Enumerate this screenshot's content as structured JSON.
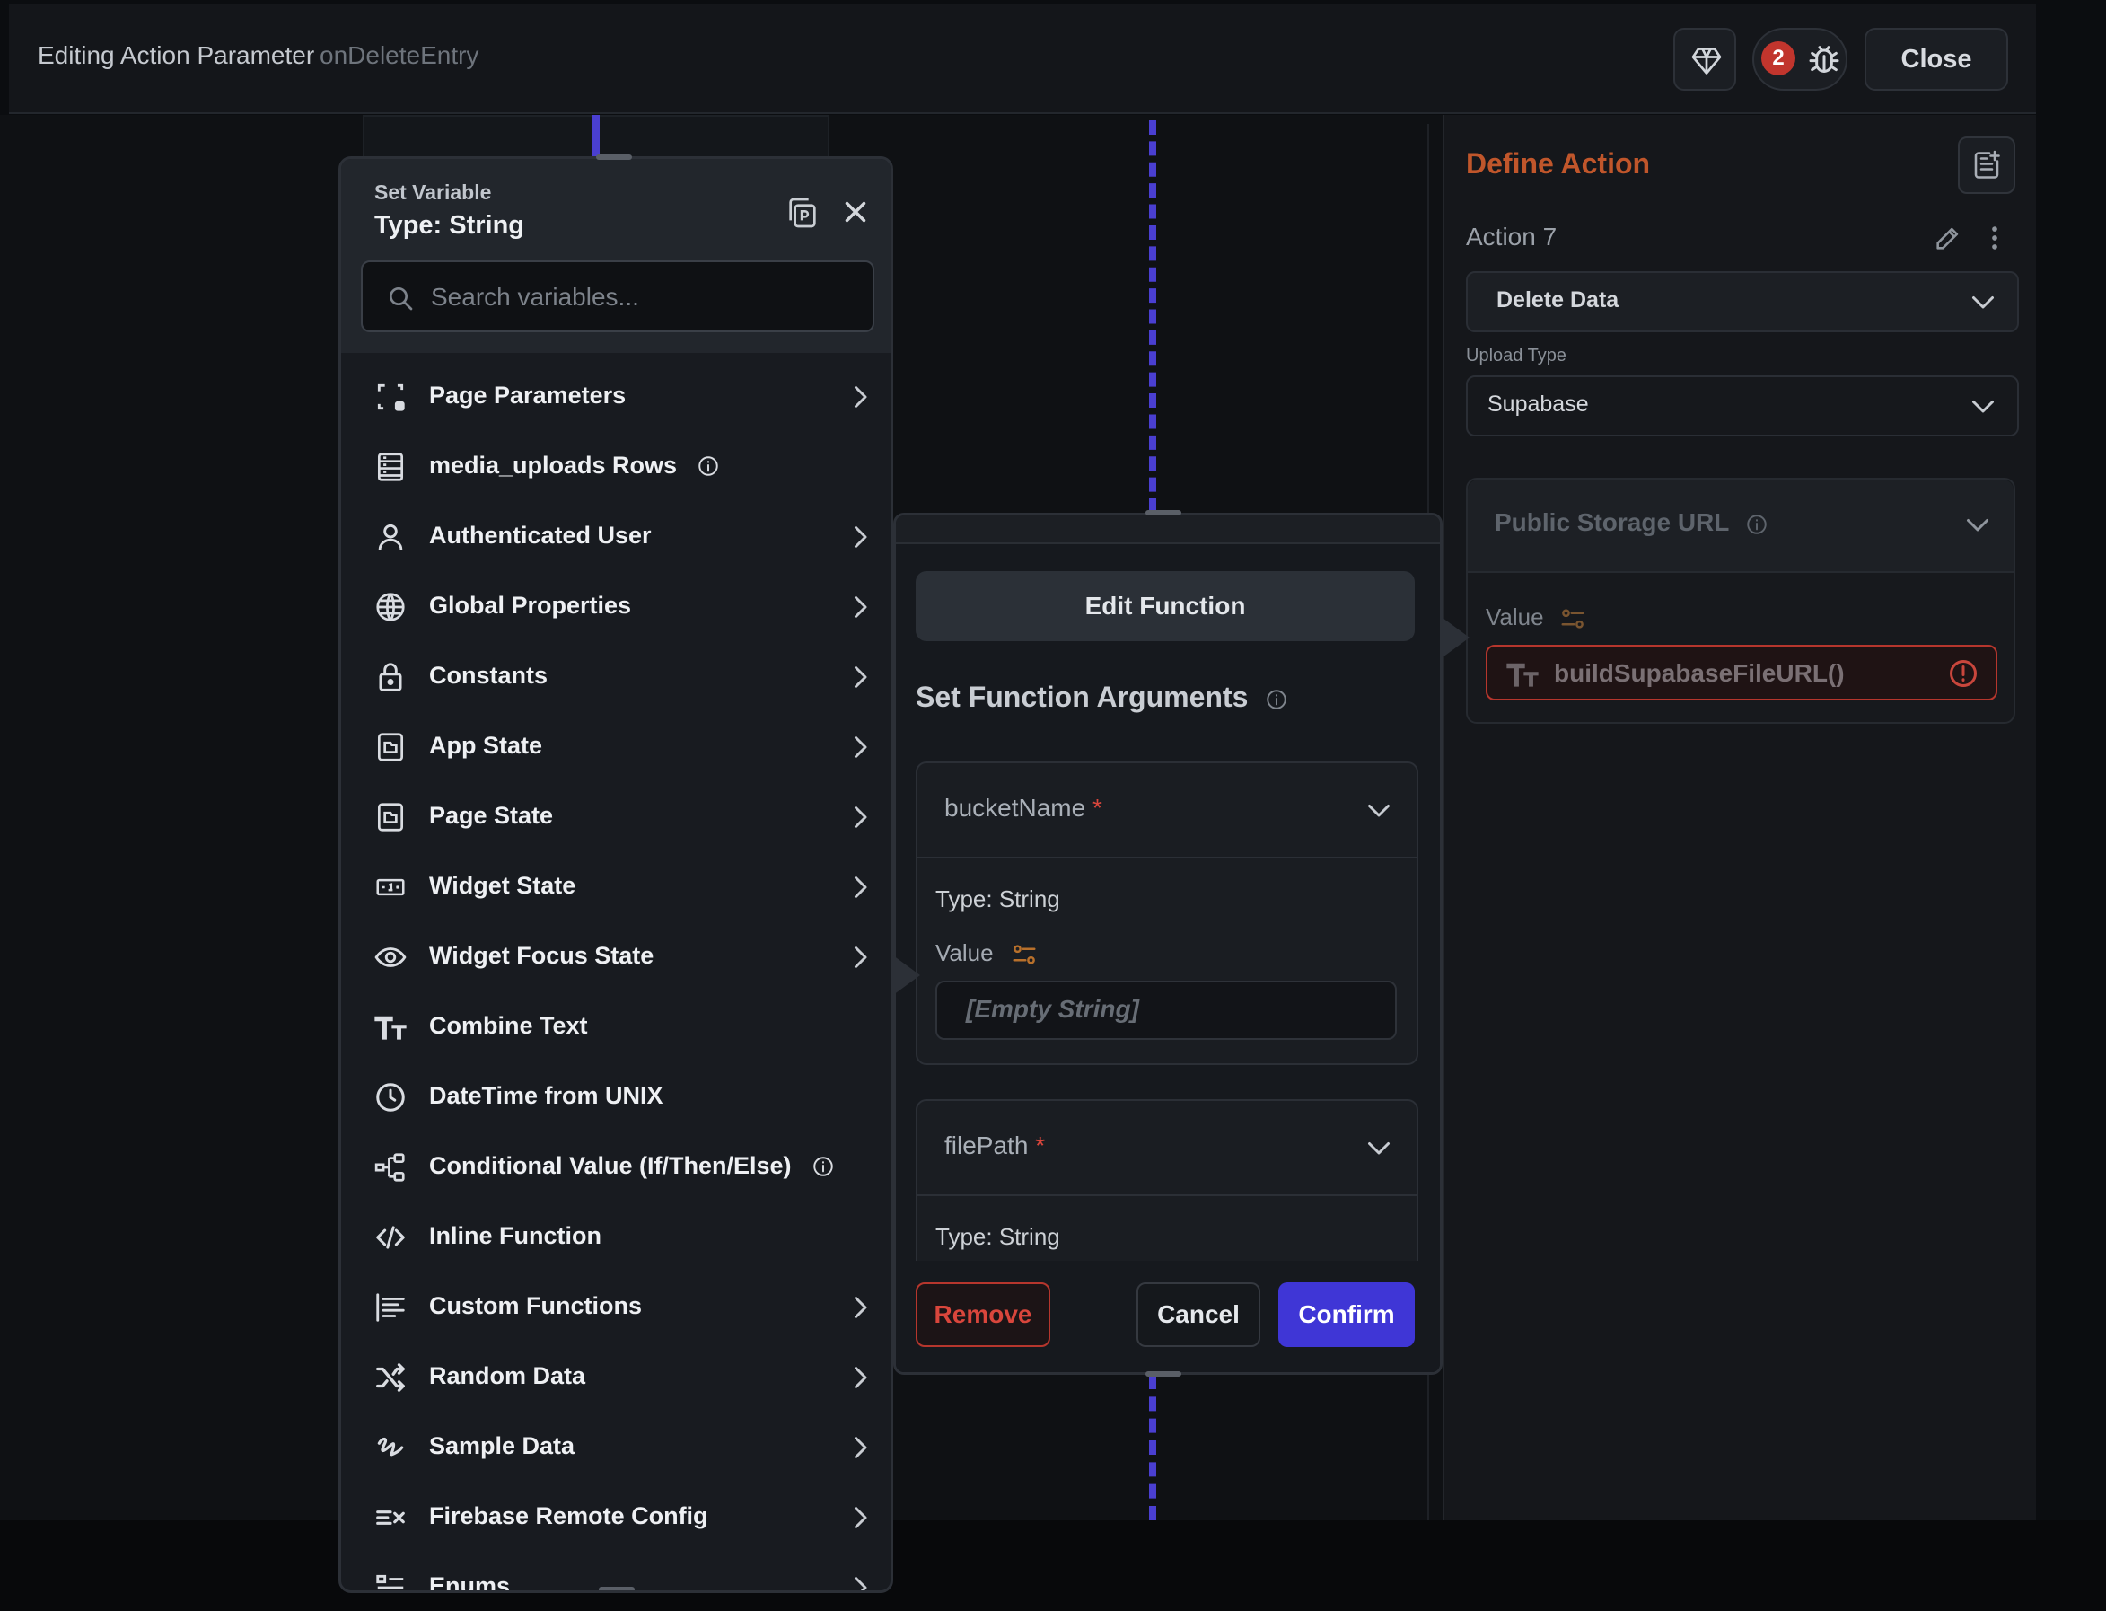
{
  "header": {
    "title": "Editing Action Parameter",
    "subtitle": "onDeleteEntry",
    "badge_count": "2",
    "close_label": "Close"
  },
  "set_variable": {
    "title": "Set Variable",
    "type_label": "Type: String",
    "search_placeholder": "Search variables...",
    "items": [
      {
        "label": "Page Parameters",
        "icon": "page-parameters-icon",
        "has_chevron": true
      },
      {
        "label": "media_uploads Rows",
        "icon": "table-rows-icon",
        "has_chevron": false,
        "has_info": true
      },
      {
        "label": "Authenticated User",
        "icon": "user-icon",
        "has_chevron": true
      },
      {
        "label": "Global Properties",
        "icon": "globe-icon",
        "has_chevron": true
      },
      {
        "label": "Constants",
        "icon": "lock-icon",
        "has_chevron": true
      },
      {
        "label": "App State",
        "icon": "app-state-icon",
        "has_chevron": true
      },
      {
        "label": "Page State",
        "icon": "page-state-icon",
        "has_chevron": true
      },
      {
        "label": "Widget State",
        "icon": "widget-state-icon",
        "has_chevron": true
      },
      {
        "label": "Widget Focus State",
        "icon": "eye-icon",
        "has_chevron": true
      },
      {
        "label": "Combine Text",
        "icon": "text-type-icon",
        "has_chevron": false
      },
      {
        "label": "DateTime from UNIX",
        "icon": "clock-icon",
        "has_chevron": false
      },
      {
        "label": "Conditional Value (If/Then/Else)",
        "icon": "conditional-icon",
        "has_chevron": false,
        "has_info": true
      },
      {
        "label": "Inline Function",
        "icon": "code-icon",
        "has_chevron": false
      },
      {
        "label": "Custom Functions",
        "icon": "custom-functions-icon",
        "has_chevron": true
      },
      {
        "label": "Random Data",
        "icon": "shuffle-icon",
        "has_chevron": true
      },
      {
        "label": "Sample Data",
        "icon": "sample-data-icon",
        "has_chevron": true
      },
      {
        "label": "Firebase Remote Config",
        "icon": "remote-config-icon",
        "has_chevron": true
      },
      {
        "label": "Enums",
        "icon": "enums-icon",
        "has_chevron": true
      }
    ]
  },
  "edit_function": {
    "edit_label": "Edit Function",
    "args_title": "Set Function Arguments",
    "args": [
      {
        "name": "bucketName",
        "required_mark": "*",
        "type": "Type: String",
        "value_label": "Value",
        "value": "[Empty String]"
      },
      {
        "name": "filePath",
        "required_mark": "*",
        "type": "Type: String"
      }
    ],
    "remove_label": "Remove",
    "cancel_label": "Cancel",
    "confirm_label": "Confirm"
  },
  "define_action": {
    "title": "Define Action",
    "action_name": "Action 7",
    "action_type": "Delete Data",
    "upload_type_label": "Upload Type",
    "upload_type": "Supabase",
    "public_storage_title": "Public Storage URL",
    "value_label": "Value",
    "value": "buildSupabaseFileURL()"
  },
  "colors": {
    "accent": "#3f36d6",
    "danger": "#d9463c",
    "define_title": "#c0562b"
  }
}
